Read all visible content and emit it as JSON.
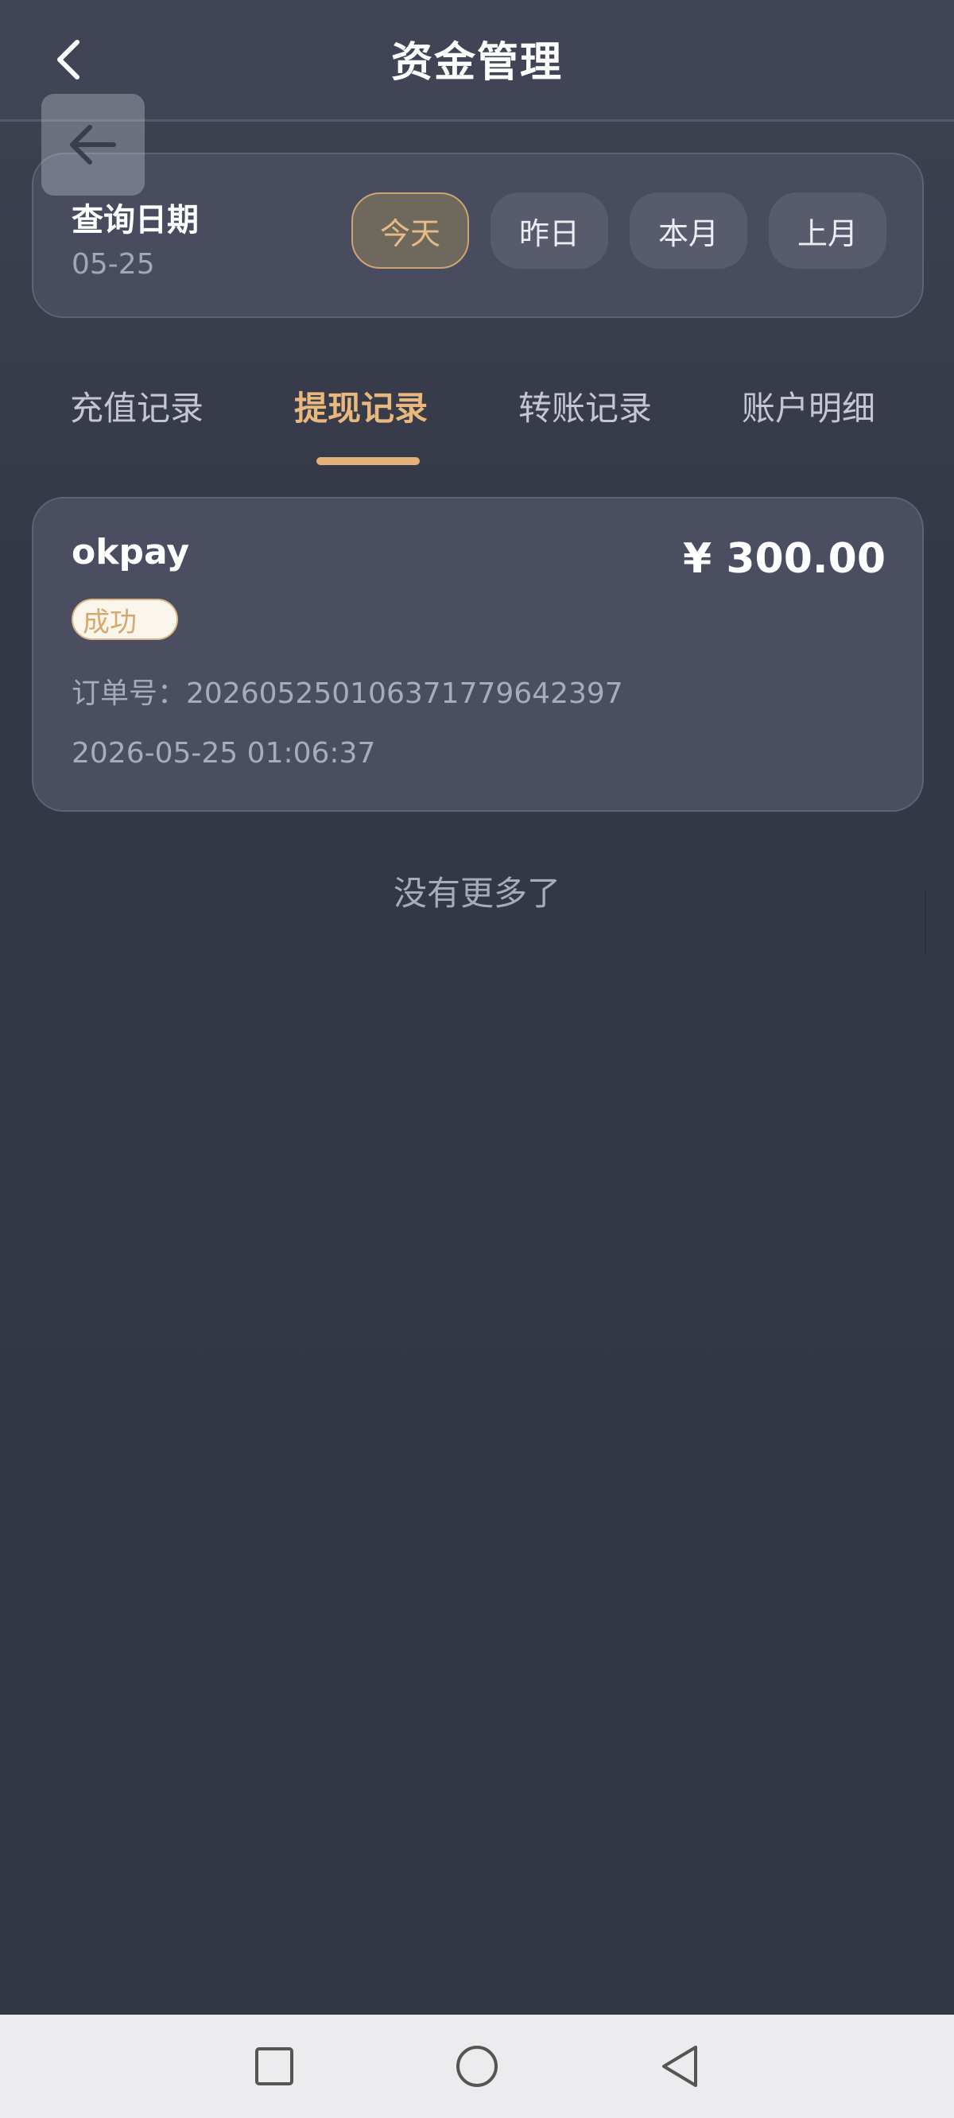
{
  "header": {
    "title": "资金管理",
    "back_icon": "chevron-left-icon"
  },
  "overlay": {
    "back_icon": "arrow-left-icon"
  },
  "date_filter": {
    "label": "查询日期",
    "value": "05-25",
    "buttons": [
      {
        "label": "今天",
        "active": true
      },
      {
        "label": "昨日",
        "active": false
      },
      {
        "label": "本月",
        "active": false
      },
      {
        "label": "上月",
        "active": false
      }
    ]
  },
  "tabs": [
    {
      "label": "充值记录",
      "active": false
    },
    {
      "label": "提现记录",
      "active": true
    },
    {
      "label": "转账记录",
      "active": false
    },
    {
      "label": "账户明细",
      "active": false
    }
  ],
  "records": [
    {
      "channel": "okpay",
      "amount": "¥ 300.00",
      "status": "成功",
      "order": "订单号：20260525010637177964​2397",
      "time": "2026-05-25 01:06:37"
    }
  ],
  "list_footer": "没有更多了",
  "system_nav": {
    "icons": [
      "recent-apps-icon",
      "home-icon",
      "back-icon"
    ]
  },
  "colors": {
    "accent": "#e8b87c",
    "background": "#353947",
    "card": "#4a4e60"
  }
}
